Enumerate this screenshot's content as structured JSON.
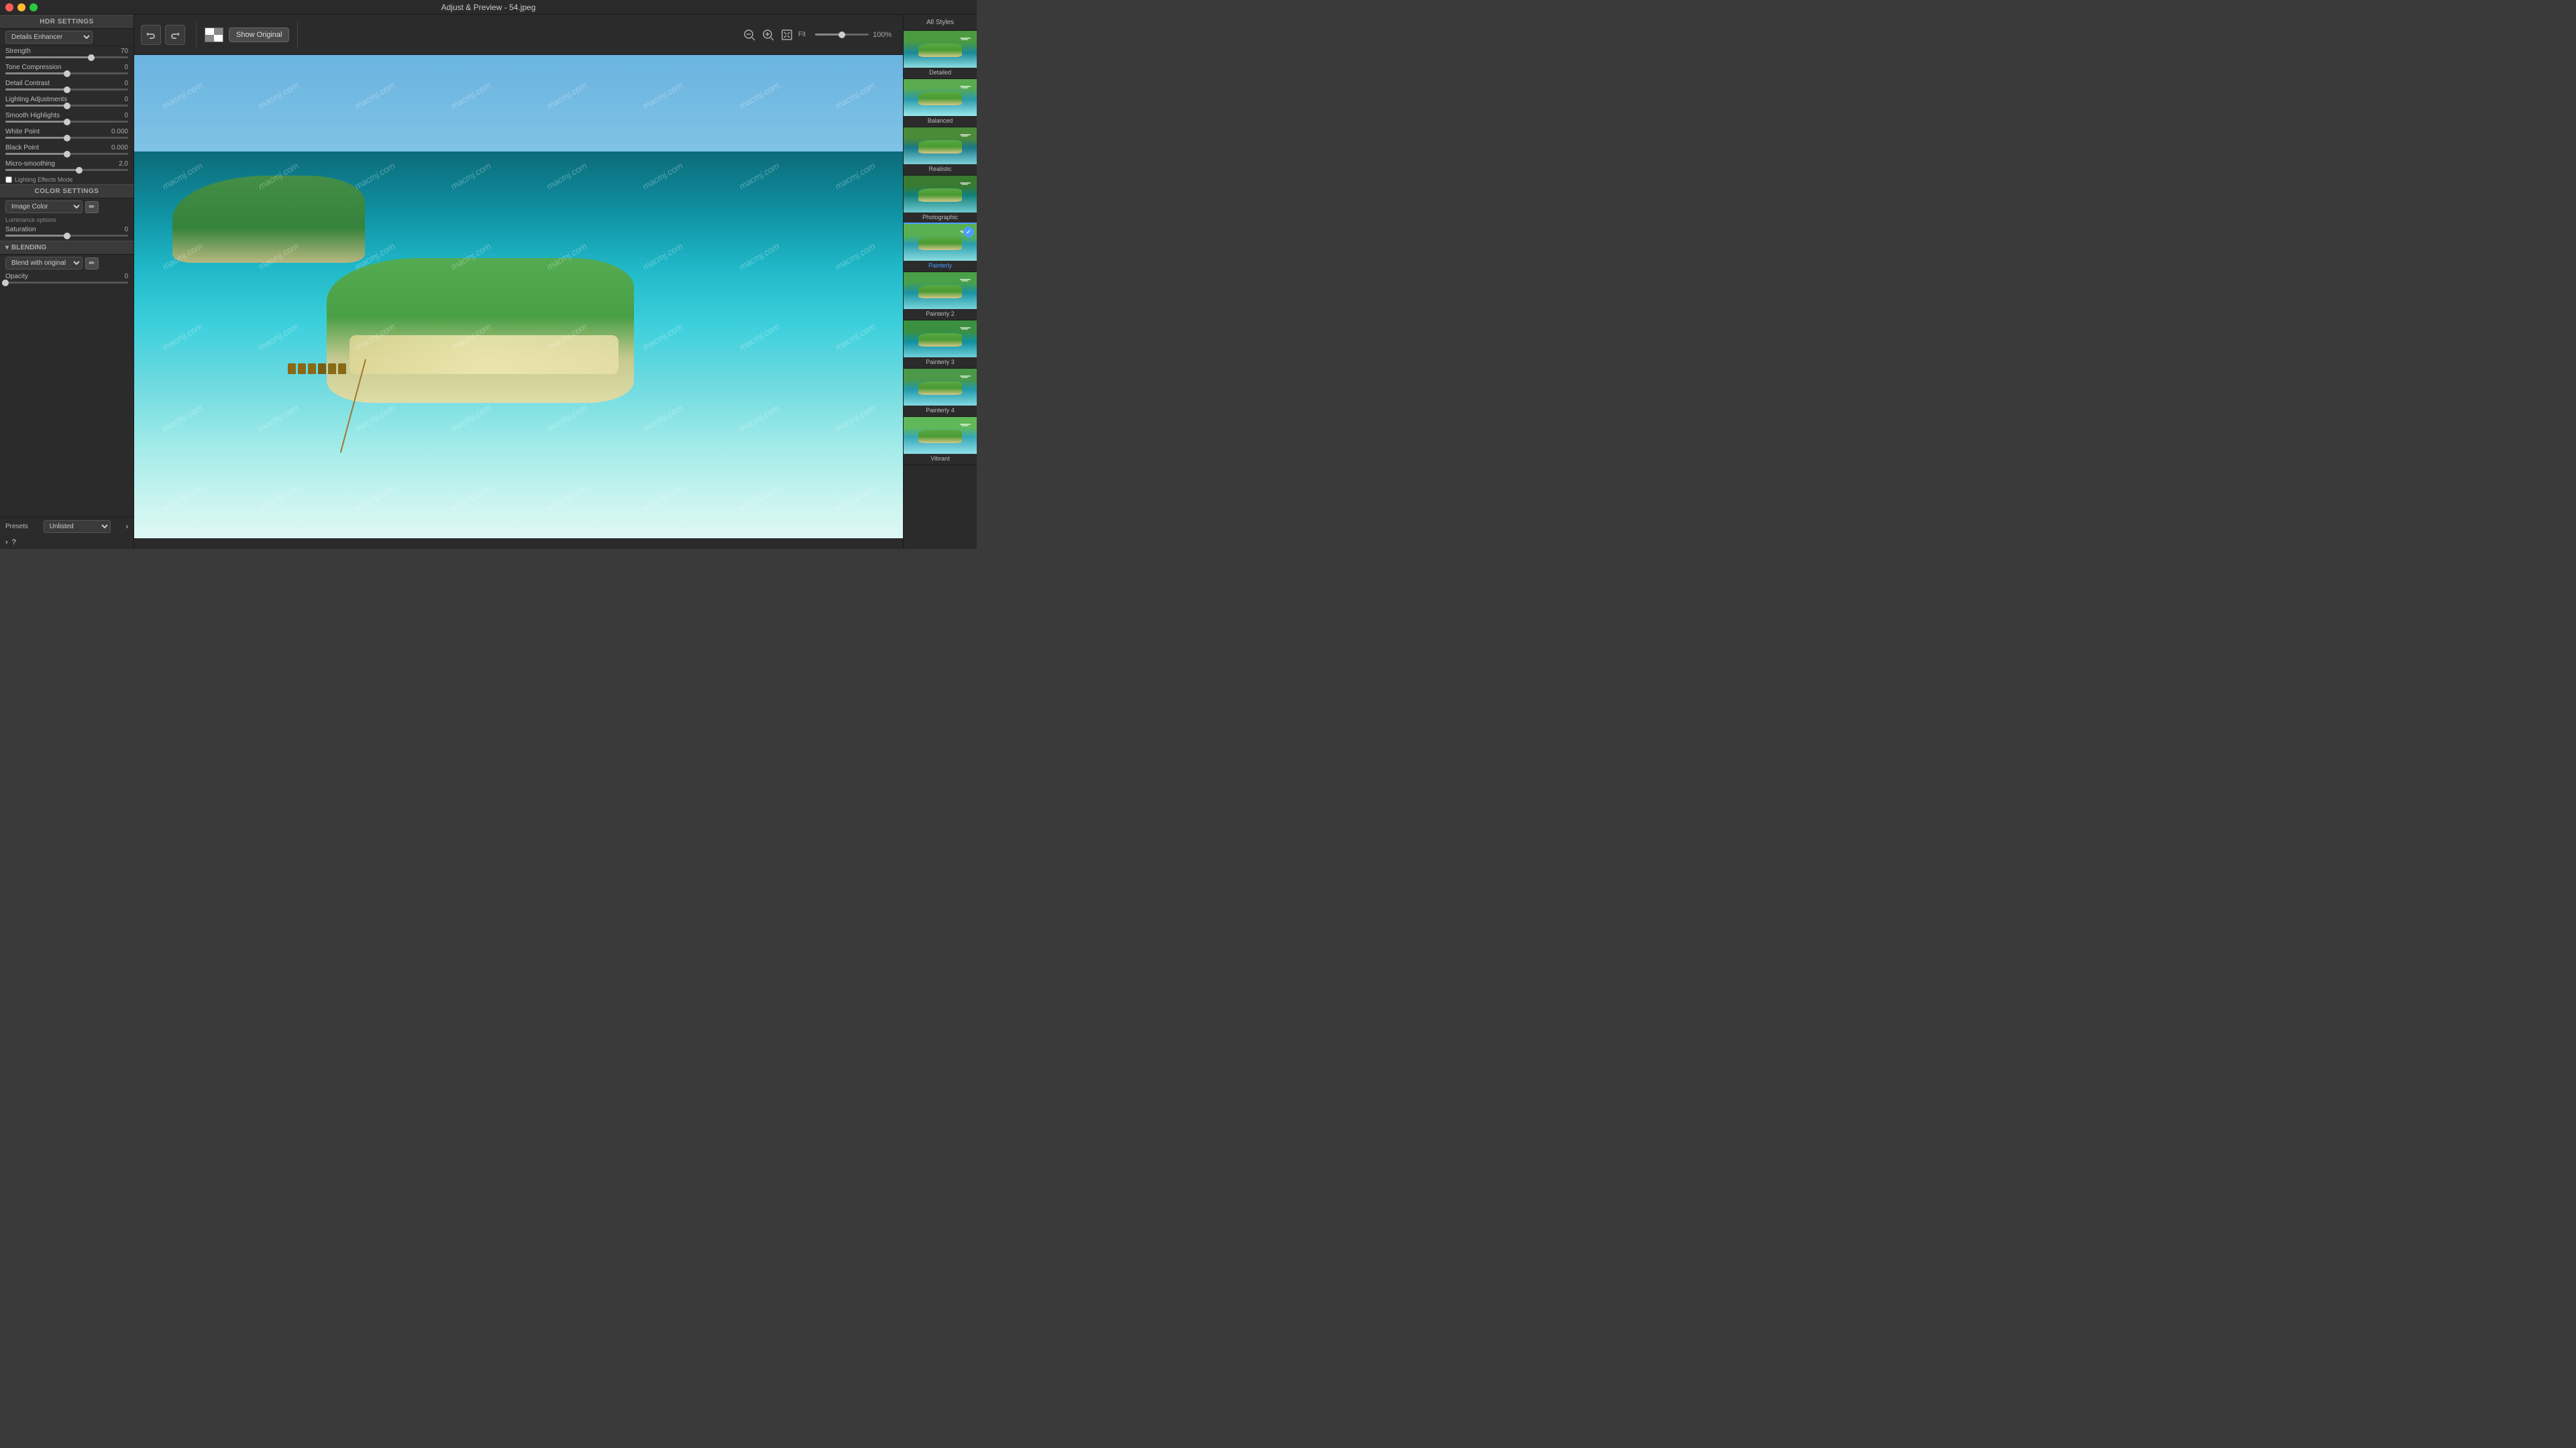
{
  "titlebar": {
    "title": "Adjust & Preview - 54.jpeg"
  },
  "toolbar": {
    "undo_icon": "↩",
    "undo_label": "Undo",
    "redo_icon": "↪",
    "redo_label": "Redo",
    "show_original_label": "Show Original",
    "fit_label": "Fit",
    "zoom_percent": "100%"
  },
  "left_panel": {
    "hdr_section_label": "HDR SETTINGS",
    "preset_dropdown": "Details Enhancer",
    "sliders": [
      {
        "label": "Strength",
        "value": "70",
        "percent": 70
      },
      {
        "label": "Tone Compression",
        "value": "0",
        "percent": 50
      },
      {
        "label": "Detail Contrast",
        "value": "0",
        "percent": 50
      },
      {
        "label": "Lighting Adjustments",
        "value": "0",
        "percent": 50
      },
      {
        "label": "Smooth Highlights",
        "value": "0",
        "percent": 50
      },
      {
        "label": "White Point",
        "value": "0.000",
        "percent": 50
      },
      {
        "label": "Black Point",
        "value": "0.000",
        "percent": 50
      },
      {
        "label": "Micro-smoothing",
        "value": "2.0",
        "percent": 60
      }
    ],
    "lighting_effects_mode_label": "Lighting Effects Mode",
    "color_section_label": "COLOR SETTINGS",
    "color_mode_dropdown": "Image Color",
    "color_options_label": "Luminance options",
    "saturation_label": "Saturation",
    "saturation_value": "0",
    "blending_section_label": "BLENDING",
    "blend_dropdown": "Blend with original",
    "opacity_label": "Opacity",
    "opacity_value": "0",
    "presets_label": "Presets",
    "presets_dropdown": "Unlisted"
  },
  "right_panel": {
    "header": "All Styles",
    "styles": [
      {
        "name": "Detailed",
        "active": false
      },
      {
        "name": "Balanced",
        "active": false
      },
      {
        "name": "Realistic",
        "active": false
      },
      {
        "name": "Photographic",
        "active": false
      },
      {
        "name": "Painterly",
        "active": true
      },
      {
        "name": "Painterly 2",
        "active": false
      },
      {
        "name": "Painterly 3",
        "active": false
      },
      {
        "name": "Painterly 4",
        "active": false
      },
      {
        "name": "Vibrant",
        "active": false
      }
    ]
  },
  "watermarks": [
    "macmj.com",
    "macmj.com",
    "macmj.com",
    "macmj.com",
    "macmj.com",
    "macmj.com",
    "macmj.com",
    "macmj.com",
    "macmj.com",
    "macmj.com",
    "macmj.com",
    "macmj.com",
    "macmj.com",
    "macmj.com",
    "macmj.com",
    "macmj.com",
    "macmj.com",
    "macmj.com",
    "macmj.com",
    "macmj.com",
    "macmj.com",
    "macmj.com",
    "macmj.com",
    "macmj.com",
    "macmj.com",
    "macmj.com",
    "macmj.com",
    "macmj.com",
    "macmj.com",
    "macmj.com",
    "macmj.com",
    "macmj.com",
    "macmj.com",
    "macmj.com",
    "macmj.com",
    "macmj.com",
    "macmj.com",
    "macmj.com",
    "macmj.com",
    "macmj.com",
    "macmj.com",
    "macmj.com",
    "macmj.com",
    "macmj.com",
    "macmj.com",
    "macmj.com",
    "macmj.com",
    "macmj.com"
  ]
}
